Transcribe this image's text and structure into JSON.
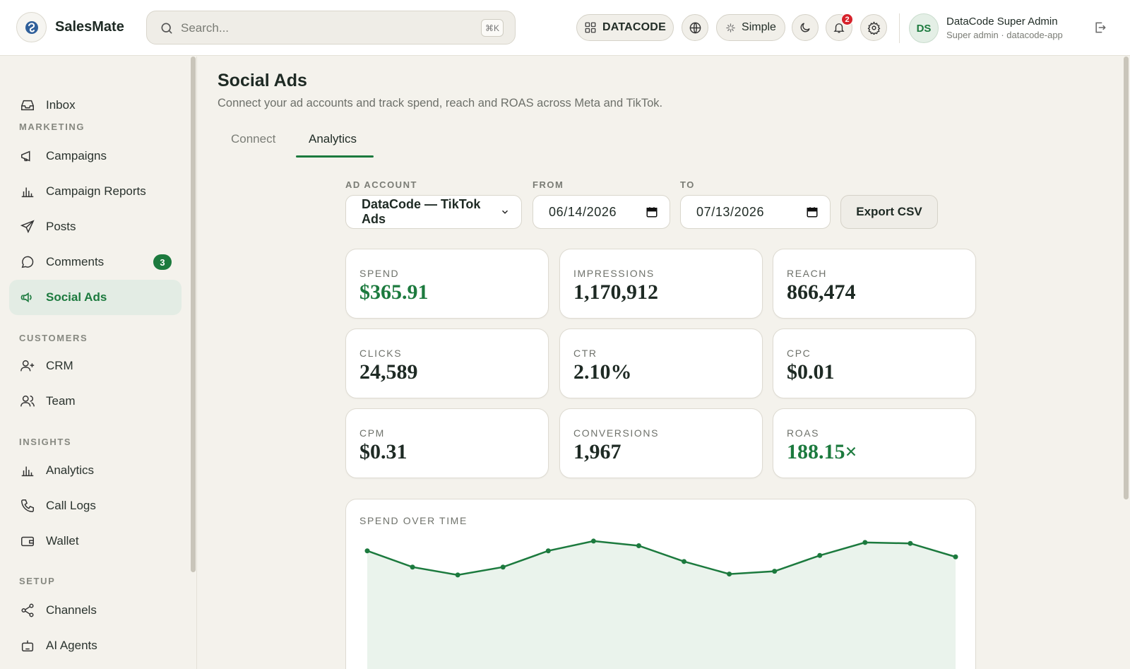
{
  "app": {
    "name": "SalesMate"
  },
  "header": {
    "search_placeholder": "Search...",
    "shortcut": "⌘K",
    "workspace": "DATACODE",
    "mode": "Simple",
    "notifications": "2",
    "user": {
      "initials": "DS",
      "name": "DataCode Super Admin",
      "subtitle": "Super admin · datacode-app"
    }
  },
  "sidebar": {
    "top": [
      {
        "label": "Inbox",
        "icon": "inbox-icon"
      }
    ],
    "sections": [
      {
        "title": "MARKETING",
        "items": [
          {
            "label": "Campaigns",
            "icon": "megaphone-icon"
          },
          {
            "label": "Campaign Reports",
            "icon": "bar-chart-icon"
          },
          {
            "label": "Posts",
            "icon": "send-icon"
          },
          {
            "label": "Comments",
            "icon": "comment-icon",
            "badge": "3"
          },
          {
            "label": "Social Ads",
            "icon": "speaker-icon",
            "active": true
          }
        ]
      },
      {
        "title": "CUSTOMERS",
        "items": [
          {
            "label": "CRM",
            "icon": "user-plus-icon"
          },
          {
            "label": "Team",
            "icon": "users-icon"
          }
        ]
      },
      {
        "title": "INSIGHTS",
        "items": [
          {
            "label": "Analytics",
            "icon": "bar-chart-icon"
          },
          {
            "label": "Call Logs",
            "icon": "phone-icon"
          },
          {
            "label": "Wallet",
            "icon": "wallet-icon"
          }
        ]
      },
      {
        "title": "SETUP",
        "items": [
          {
            "label": "Channels",
            "icon": "share-icon"
          },
          {
            "label": "AI Agents",
            "icon": "bot-icon"
          }
        ]
      }
    ]
  },
  "page": {
    "title": "Social Ads",
    "subtitle": "Connect your ad accounts and track spend, reach and ROAS across Meta and TikTok.",
    "tabs": [
      {
        "label": "Connect"
      },
      {
        "label": "Analytics",
        "active": true
      }
    ]
  },
  "filters": {
    "account_label": "AD ACCOUNT",
    "account_value": "DataCode — TikTok Ads",
    "from_label": "FROM",
    "from_value": "06/14/2026",
    "to_label": "TO",
    "to_value": "07/13/2026",
    "export_label": "Export CSV"
  },
  "metrics": [
    {
      "label": "SPEND",
      "value": "$365.91",
      "accent": true
    },
    {
      "label": "IMPRESSIONS",
      "value": "1,170,912"
    },
    {
      "label": "REACH",
      "value": "866,474"
    },
    {
      "label": "CLICKS",
      "value": "24,589"
    },
    {
      "label": "CTR",
      "value": "2.10%"
    },
    {
      "label": "CPC",
      "value": "$0.01"
    },
    {
      "label": "CPM",
      "value": "$0.31"
    },
    {
      "label": "CONVERSIONS",
      "value": "1,967"
    },
    {
      "label": "ROAS",
      "value": "188.15×",
      "accent": true
    }
  ],
  "colors": {
    "accent": "#1c7a3e",
    "accent_fill": "#eaf3ec",
    "badge_red": "#d6222b"
  },
  "chart_data": {
    "type": "area",
    "title": "SPEND OVER TIME",
    "x": [
      1,
      2,
      3,
      4,
      5,
      6,
      7,
      8,
      9,
      10,
      11,
      12,
      13,
      14
    ],
    "values": [
      28.5,
      25.0,
      23.3,
      25.0,
      28.5,
      30.6,
      29.6,
      26.2,
      23.5,
      24.1,
      27.5,
      30.3,
      30.1,
      27.2
    ],
    "ylim": [
      0,
      35
    ],
    "grid": false
  }
}
